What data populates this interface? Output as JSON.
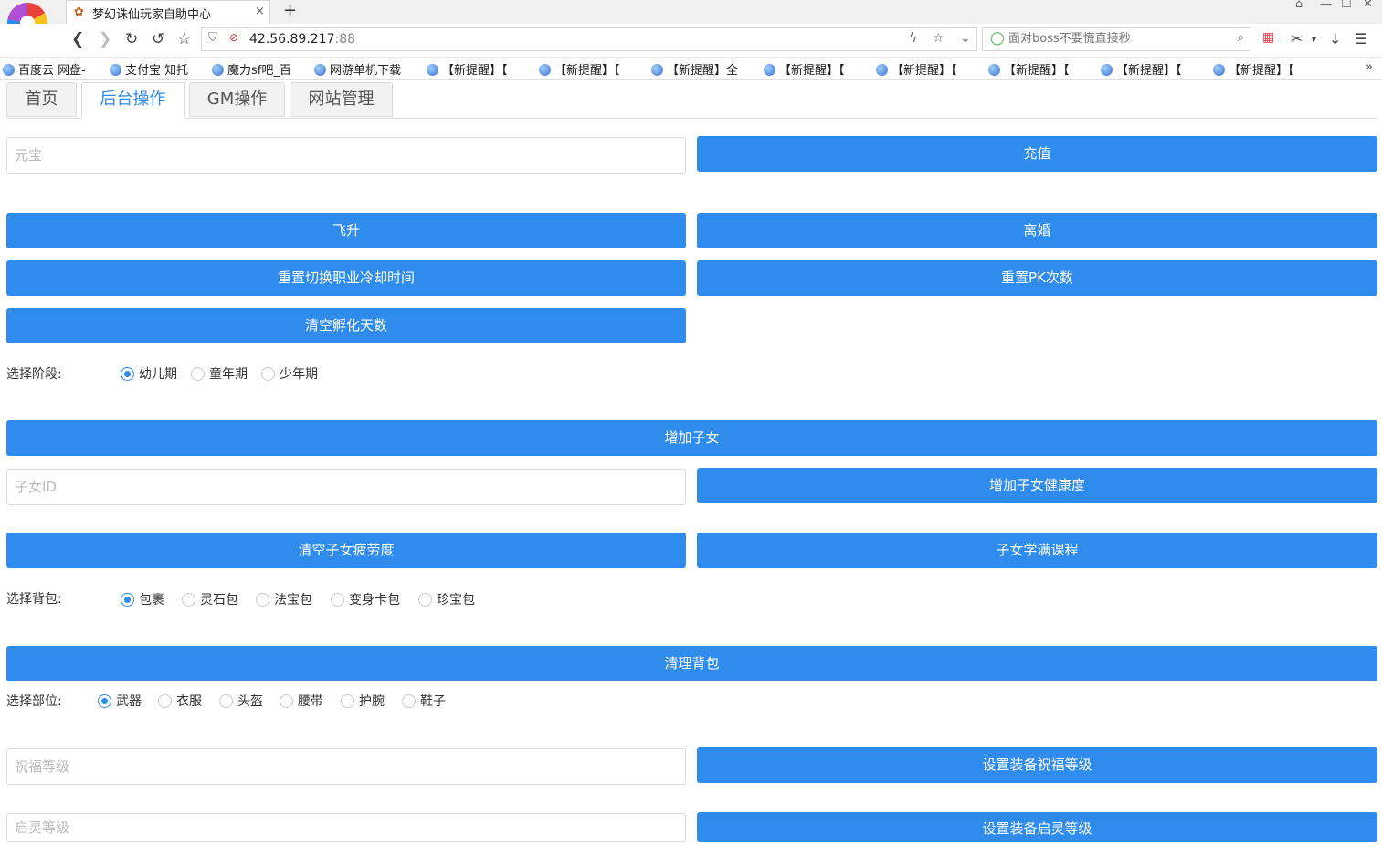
{
  "browser": {
    "tab_title": "梦幻诛仙玩家自助中心",
    "tab_close": "×",
    "new_tab": "+",
    "address": {
      "host": "42.56.89.217",
      "port": ":88"
    },
    "search_placeholder": "面对boss不要慌直接秒",
    "bookmarks": [
      "百度云 网盘-",
      "支付宝 知托",
      "魔力sf吧_百",
      "网游单机下载",
      "【新提醒】【",
      "【新提醒】【",
      "【新提醒】全",
      "【新提醒】【",
      "【新提醒】【",
      "【新提醒】【",
      "【新提醒】【",
      "【新提醒】【"
    ],
    "bookmarks_more": "»"
  },
  "tabs": [
    "首页",
    "后台操作",
    "GM操作",
    "网站管理"
  ],
  "active_tab": 1,
  "form": {
    "yuanbao_placeholder": "元宝",
    "recharge": "充值",
    "ascend": "飞升",
    "divorce": "离婚",
    "reset_job_cd": "重置切换职业冷却时间",
    "reset_pk": "重置PK次数",
    "clear_incubate": "清空孵化天数",
    "stage_label": "选择阶段:",
    "stages": [
      "幼儿期",
      "童年期",
      "少年期"
    ],
    "stage_selected": 0,
    "add_child": "增加子女",
    "child_id_placeholder": "子女ID",
    "add_child_health": "增加子女健康度",
    "clear_child_fatigue": "清空子女疲劳度",
    "child_full_course": "子女学满课程",
    "bag_label": "选择背包:",
    "bags": [
      "包裹",
      "灵石包",
      "法宝包",
      "变身卡包",
      "珍宝包"
    ],
    "bag_selected": 0,
    "clean_bag": "清理背包",
    "slot_label": "选择部位:",
    "slots": [
      "武器",
      "衣服",
      "头盔",
      "腰带",
      "护腕",
      "鞋子"
    ],
    "slot_selected": 0,
    "bless_placeholder": "祝福等级",
    "set_bless": "设置装备祝福等级",
    "spirit_placeholder": "启灵等级",
    "set_spirit": "设置装备启灵等级"
  },
  "colors": {
    "accent": "#2f8bec",
    "active_tab_text": "#2e8be8"
  }
}
